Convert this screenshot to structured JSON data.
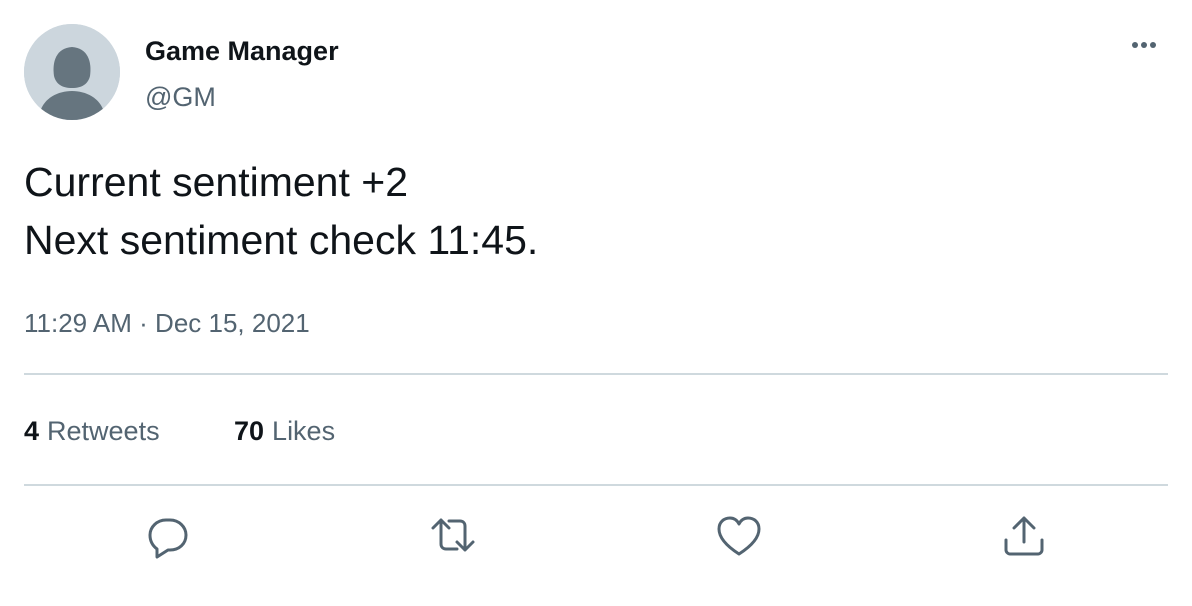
{
  "author": {
    "name": "Game Manager",
    "handle": "@GM",
    "avatar_icon": "default-avatar-icon"
  },
  "tweet": {
    "lines": [
      "Current sentiment +2",
      "Next sentiment check 11:45."
    ],
    "time": "11:29 AM",
    "separator": " · ",
    "date": "Dec 15, 2021"
  },
  "stats": {
    "retweets_count": "4",
    "retweets_label": "Retweets",
    "likes_count": "70",
    "likes_label": "Likes"
  },
  "actions": {
    "reply_icon": "reply-icon",
    "retweet_icon": "retweet-icon",
    "like_icon": "heart-icon",
    "share_icon": "share-icon",
    "more_icon": "more-options-icon"
  },
  "colors": {
    "text_primary": "#0f1419",
    "text_secondary": "#536471",
    "divider": "#cfd9de",
    "avatar_bg": "#ccd6dd",
    "avatar_fg": "#66757f"
  }
}
